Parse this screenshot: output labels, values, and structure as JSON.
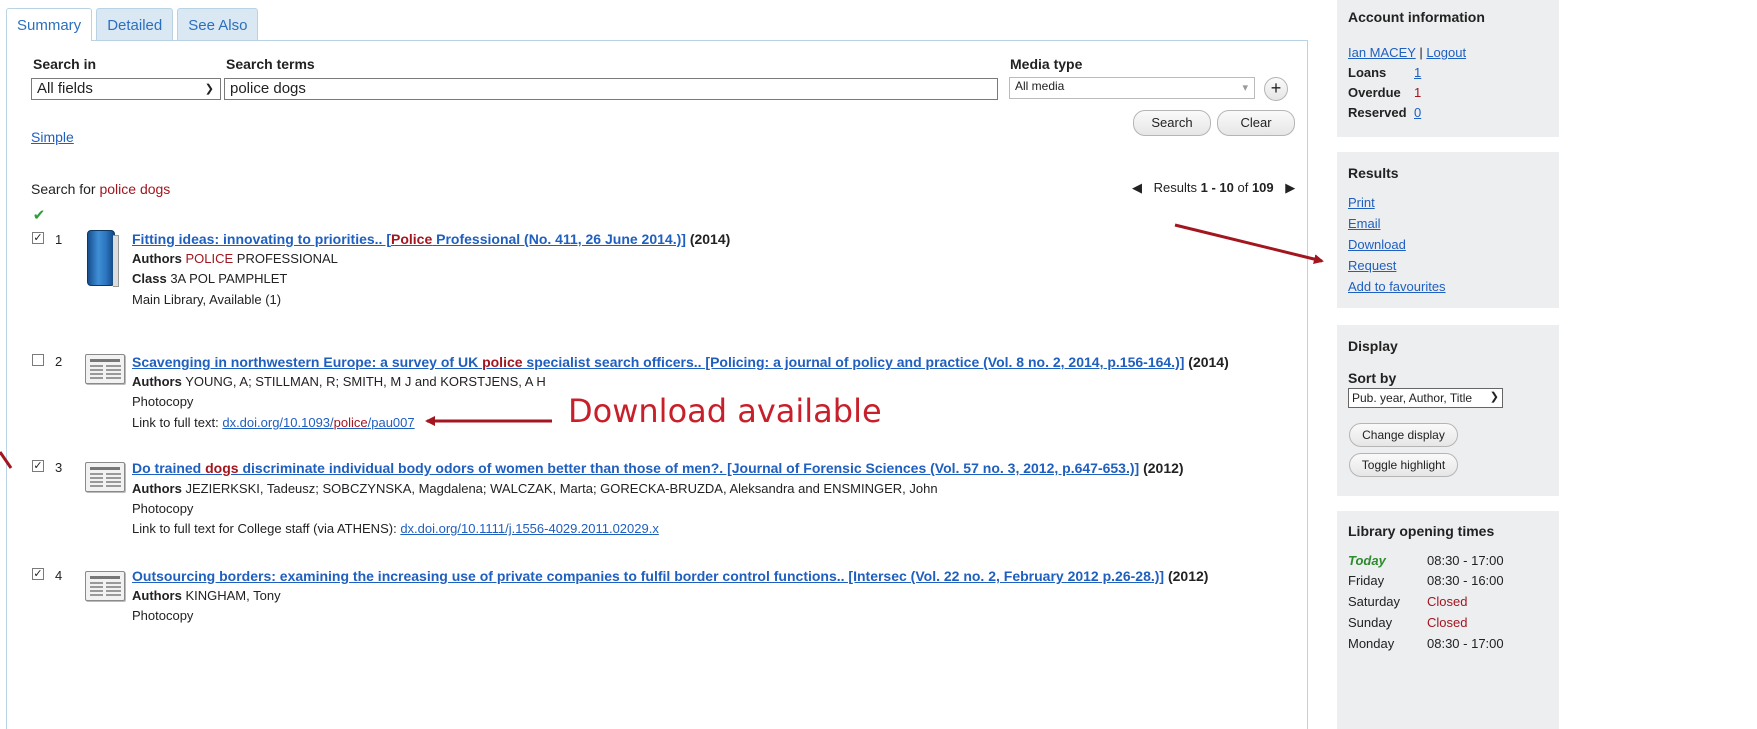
{
  "tabs": [
    "Summary",
    "Detailed",
    "See Also"
  ],
  "search": {
    "search_in_label": "Search in",
    "search_in_value": "All fields",
    "terms_label": "Search terms",
    "terms_value": "police dogs",
    "media_label": "Media type",
    "media_value": "All media",
    "plus": "+",
    "search_btn": "Search",
    "clear_btn": "Clear",
    "simple_link": "Simple"
  },
  "results_header": {
    "search_for": "Search for",
    "query": "police dogs",
    "results_prefix": "Results",
    "range": "1 - 10",
    "of": "of",
    "total": "109"
  },
  "results": [
    {
      "num": "1",
      "checked": true,
      "title_pre": "Fitting ideas: innovating to priorities.. [",
      "title_hl": "Police",
      "title_post": " Professional (No. 411, 26 June 2014.)]",
      "year": "(2014)",
      "authors_label": "Authors",
      "authors_hl": "POLICE",
      "authors_rest": " PROFESSIONAL",
      "class_label": "Class",
      "class_value": "3A POL PAMPHLET",
      "availability": "Main Library, Available (1)"
    },
    {
      "num": "2",
      "checked": false,
      "title_pre": "Scavenging in northwestern Europe: a survey of UK ",
      "title_hl": "police",
      "title_post": " specialist search officers.. [Policing: a journal of policy and practice (Vol. 8 no. 2, 2014, p.156-164.)]",
      "year": "(2014)",
      "authors_label": "Authors",
      "authors_rest": "YOUNG, A; STILLMAN, R; SMITH, M J and KORSTJENS, A H",
      "format": "Photocopy",
      "link_label": "Link to full text:",
      "link_pre": "dx.doi.org/10.1093/",
      "link_hl": "police",
      "link_post": "/pau007"
    },
    {
      "num": "3",
      "checked": true,
      "title_pre": "Do trained ",
      "title_hl": "dogs",
      "title_post": " discriminate individual body odors of women better than those of men?. [Journal of Forensic Sciences (Vol. 57 no. 3, 2012, p.647-653.)]",
      "year": "(2012)",
      "authors_label": "Authors",
      "authors_rest": "JEZIERKSKI, Tadeusz; SOBCZYNSKA, Magdalena; WALCZAK, Marta; GORECKA-BRUZDA, Aleksandra and ENSMINGER, John",
      "format": "Photocopy",
      "link_label": "Link to full text for College staff (via ATHENS):",
      "link": "dx.doi.org/10.1111/j.1556-4029.2011.02029.x"
    },
    {
      "num": "4",
      "checked": true,
      "title": "Outsourcing borders: examining the increasing use of private companies to fulfil border control functions.. [Intersec (Vol. 22 no. 2, February 2012 p.26-28.)]",
      "year": "(2012)",
      "authors_label": "Authors",
      "authors_rest": "KINGHAM, Tony",
      "format": "Photocopy"
    }
  ],
  "annotation": "Download available",
  "sidebar": {
    "account": {
      "title": "Account information",
      "user": "Ian MACEY",
      "sep": "|",
      "logout": "Logout",
      "loans_label": "Loans",
      "loans_value": "1",
      "overdue_label": "Overdue",
      "overdue_value": "1",
      "reserved_label": "Reserved",
      "reserved_value": "0"
    },
    "results": {
      "title": "Results",
      "links": [
        "Print",
        "Email",
        "Download",
        "Request",
        "Add to favourites"
      ]
    },
    "display": {
      "title": "Display",
      "sort_label": "Sort by",
      "sort_value": "Pub. year, Author, Title",
      "change_btn": "Change display",
      "toggle_btn": "Toggle highlight"
    },
    "hours": {
      "title": "Library opening times",
      "rows": [
        {
          "day": "Today",
          "time": "08:30 - 17:00"
        },
        {
          "day": "Friday",
          "time": "08:30 - 16:00"
        },
        {
          "day": "Saturday",
          "time": "Closed"
        },
        {
          "day": "Sunday",
          "time": "Closed"
        },
        {
          "day": "Monday",
          "time": "08:30 - 17:00"
        }
      ]
    }
  },
  "colors": {
    "link": "#1f5fbf",
    "highlight": "#a3151f",
    "arrow": "#a3151f",
    "annotation": "#c8202a",
    "today": "#2e8b2e",
    "sidebar_bg": "#eceef0"
  }
}
